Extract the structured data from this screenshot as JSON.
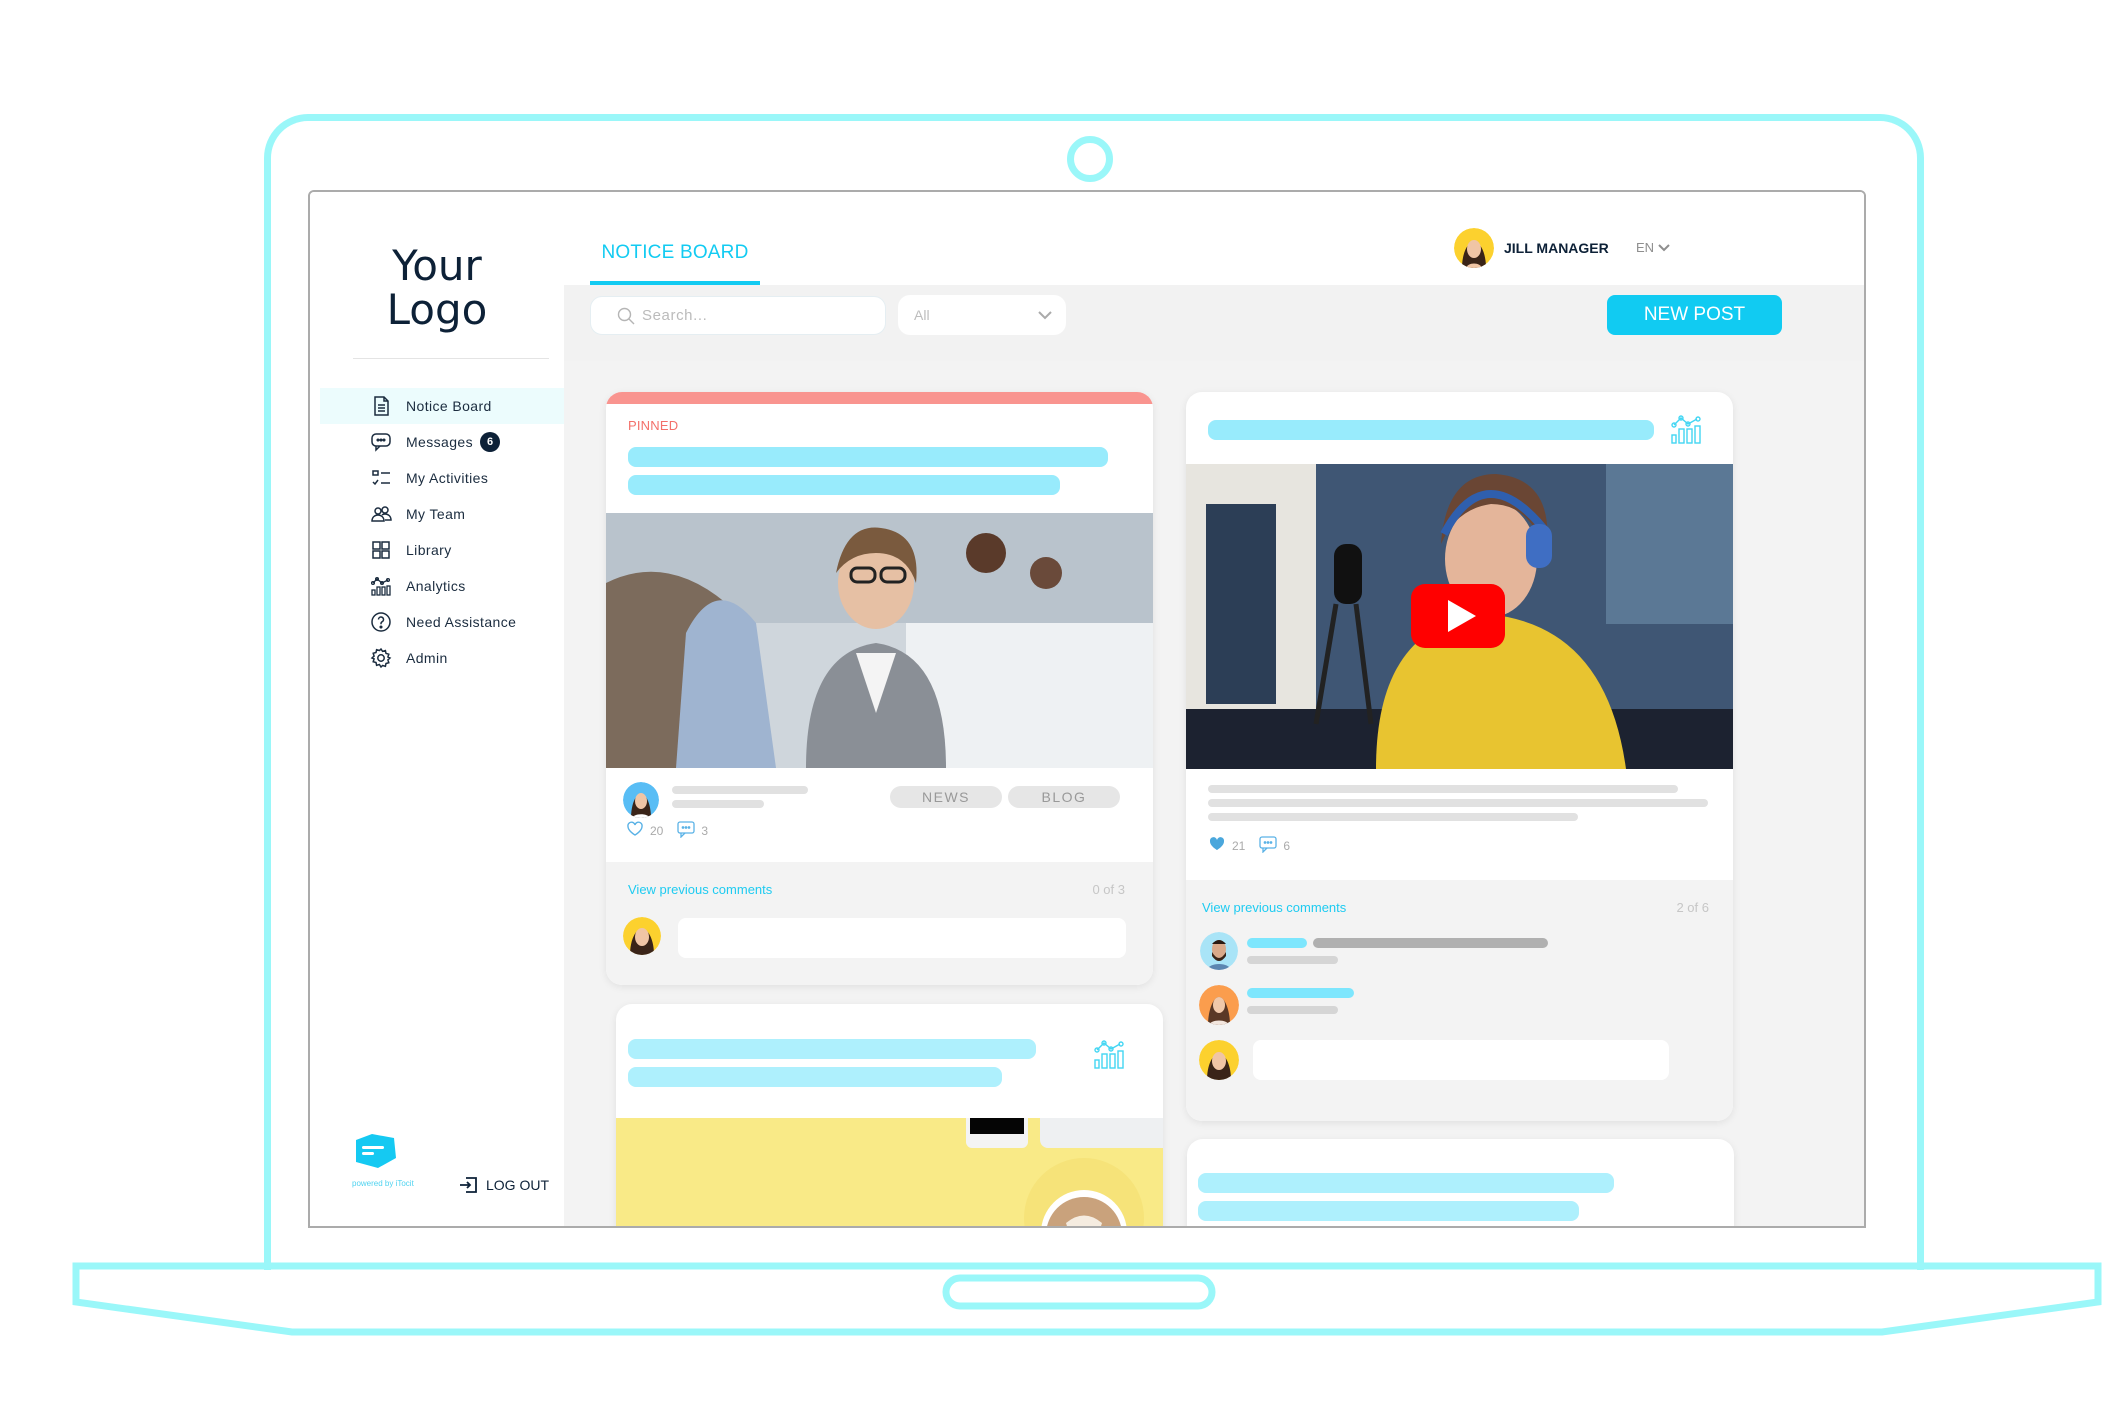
{
  "sidebar": {
    "logo_line1": "Your",
    "logo_line2": "Logo",
    "items": [
      {
        "label": "Notice Board",
        "icon": "document-icon",
        "active": true
      },
      {
        "label": "Messages",
        "icon": "chat-bubble-icon",
        "badge": "6"
      },
      {
        "label": "My Activities",
        "icon": "checklist-icon"
      },
      {
        "label": "My Team",
        "icon": "team-icon"
      },
      {
        "label": "Library",
        "icon": "grid-icon"
      },
      {
        "label": "Analytics",
        "icon": "analytics-icon"
      },
      {
        "label": "Need Assistance",
        "icon": "help-circle-icon"
      },
      {
        "label": "Admin",
        "icon": "gear-icon"
      }
    ],
    "powered_by": "powered by iTocit",
    "logout_label": "LOG OUT"
  },
  "header": {
    "tab_label": "NOTICE BOARD",
    "user_name": "JILL MANAGER",
    "language": "EN"
  },
  "toolbar": {
    "search_placeholder": "Search...",
    "filter_selected": "All",
    "new_post_label": "NEW POST"
  },
  "colors": {
    "accent": "#12cbf2",
    "pinned": "#f3706a",
    "navy": "#0d2137",
    "outline": "#9af7f9"
  },
  "posts": [
    {
      "pinned_label": "PINNED",
      "image": "office-meeting-photo",
      "tags": [
        "NEWS",
        "BLOG"
      ],
      "likes": "20",
      "comments": "3",
      "view_comments_label": "View previous comments",
      "comment_count": "0 of 3"
    },
    {
      "image": "podcast-video-thumbnail",
      "has_video": true,
      "likes": "21",
      "comments": "6",
      "liked": true,
      "view_comments_label": "View previous comments",
      "comment_count": "2 of  6"
    },
    {
      "image": "coffee-desk-photo"
    },
    {}
  ]
}
